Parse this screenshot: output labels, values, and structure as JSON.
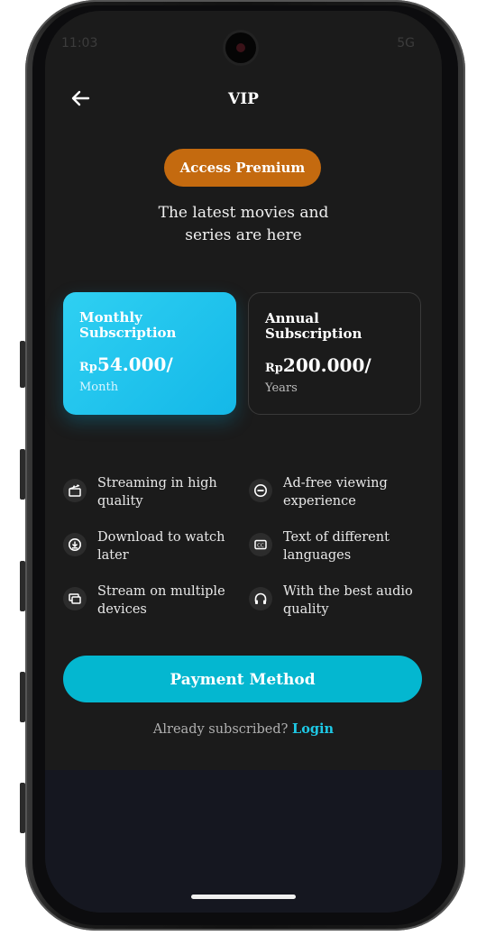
{
  "status": {
    "time": "11:03",
    "network": "5G"
  },
  "header": {
    "title": "VIP"
  },
  "badge": {
    "label": "Access Premium"
  },
  "tagline": {
    "line1": "The latest movies and",
    "line2": "series are here"
  },
  "plans": [
    {
      "name": "Monthly Subscription",
      "currency": "Rp",
      "amount": "54.000/",
      "period": "Month",
      "selected": true
    },
    {
      "name": "Annual Subscription",
      "currency": "Rp",
      "amount": "200.000/",
      "period": "Years",
      "selected": false
    }
  ],
  "features": [
    {
      "icon": "clapperboard-icon",
      "text": "Streaming in high quality"
    },
    {
      "icon": "no-ads-icon",
      "text": "Ad-free viewing experience"
    },
    {
      "icon": "download-icon",
      "text": "Download to watch later"
    },
    {
      "icon": "subtitles-icon",
      "text": "Text of different languages"
    },
    {
      "icon": "multi-device-icon",
      "text": "Stream on multiple devices"
    },
    {
      "icon": "headphones-icon",
      "text": "With the best audio quality"
    }
  ],
  "actions": {
    "payment_label": "Payment Method",
    "already_text": "Already subscribed?",
    "login_label": "Login"
  },
  "colors": {
    "accent": "#04b7d0",
    "badge": "#c46a0f",
    "background": "#1b1b1b",
    "card_selected": "#2fd0f2"
  }
}
